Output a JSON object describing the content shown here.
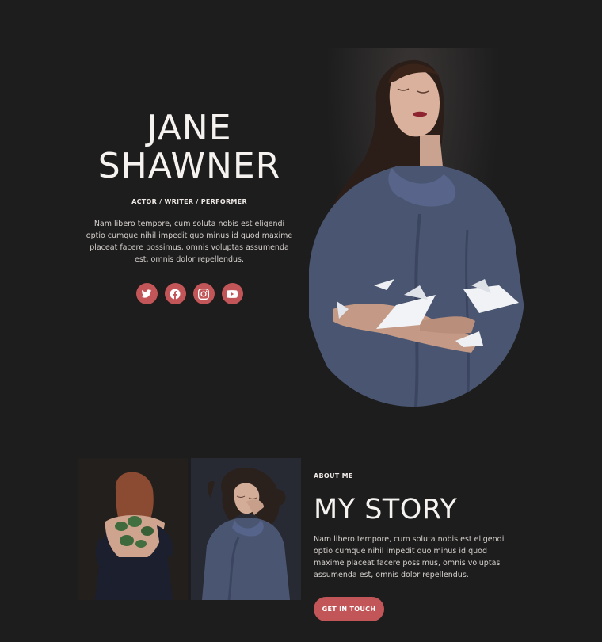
{
  "hero": {
    "name_line1": "JANE",
    "name_line2": "SHAWNER",
    "role": "ACTOR / WRITER / PERFORMER",
    "bio": "Nam libero tempore, cum soluta nobis est eligendi optio cumque nihil impedit quo minus id quod maxime placeat facere possimus, omnis voluptas assumenda est, omnis dolor repellendus.",
    "socials": [
      "twitter-icon",
      "facebook-icon",
      "instagram-icon",
      "youtube-icon"
    ]
  },
  "about": {
    "kicker": "ABOUT ME",
    "title": "MY STORY",
    "bio": "Nam libero tempore, cum soluta nobis est eligendi optio cumque nihil impedit quo minus id quod maxime placeat facere possimus, omnis voluptas assumenda est, omnis dolor repellendus.",
    "cta_label": "GET IN TOUCH"
  },
  "colors": {
    "background": "#1d1d1d",
    "accent": "#c25557",
    "text": "#f5f2f0"
  }
}
